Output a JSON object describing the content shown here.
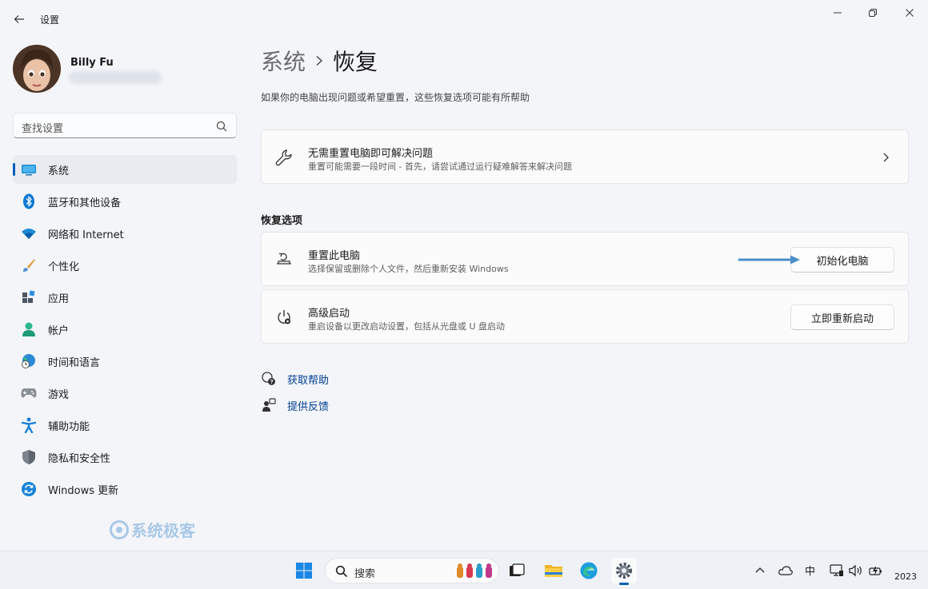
{
  "window": {
    "title": "设置",
    "back_icon": "back-arrow-icon",
    "minimize_icon": "minimize-icon",
    "maximize_icon": "restore-icon",
    "close_icon": "close-icon"
  },
  "profile": {
    "name": "Billy Fu",
    "email": ""
  },
  "search": {
    "placeholder": "查找设置"
  },
  "sidebar": {
    "items": [
      {
        "label": "系统",
        "icon": "system-icon",
        "active": true
      },
      {
        "label": "蓝牙和其他设备",
        "icon": "bluetooth-icon"
      },
      {
        "label": "网络和 Internet",
        "icon": "wifi-icon"
      },
      {
        "label": "个性化",
        "icon": "brush-icon"
      },
      {
        "label": "应用",
        "icon": "apps-icon"
      },
      {
        "label": "帐户",
        "icon": "account-icon"
      },
      {
        "label": "时间和语言",
        "icon": "globe-clock-icon"
      },
      {
        "label": "游戏",
        "icon": "gamepad-icon"
      },
      {
        "label": "辅助功能",
        "icon": "accessibility-icon"
      },
      {
        "label": "隐私和安全性",
        "icon": "shield-icon"
      },
      {
        "label": "Windows 更新",
        "icon": "update-icon"
      }
    ]
  },
  "watermark": "系统极客",
  "main": {
    "breadcrumb_parent": "系统",
    "breadcrumb_current": "恢复",
    "description": "如果你的电脑出现问题或希望重置，这些恢复选项可能有所帮助",
    "troubleshoot": {
      "title": "无需重置电脑即可解决问题",
      "subtitle": "重置可能需要一段时间 - 首先，请尝试通过运行疑难解答来解决问题"
    },
    "section_title": "恢复选项",
    "reset": {
      "title": "重置此电脑",
      "subtitle": "选择保留或删除个人文件，然后重新安装 Windows",
      "button": "初始化电脑"
    },
    "advanced": {
      "title": "高级启动",
      "subtitle": "重启设备以更改启动设置，包括从光盘或 U 盘启动",
      "button": "立即重新启动"
    },
    "links": {
      "help": "获取帮助",
      "feedback": "提供反馈"
    }
  },
  "taskbar": {
    "search_label": "搜索",
    "tray_ime": "中",
    "clock_year": "2023"
  },
  "colors": {
    "accent": "#005fb8",
    "link": "#003e92",
    "background": "#f3f5f9",
    "arrow": "#4a8ec9"
  }
}
